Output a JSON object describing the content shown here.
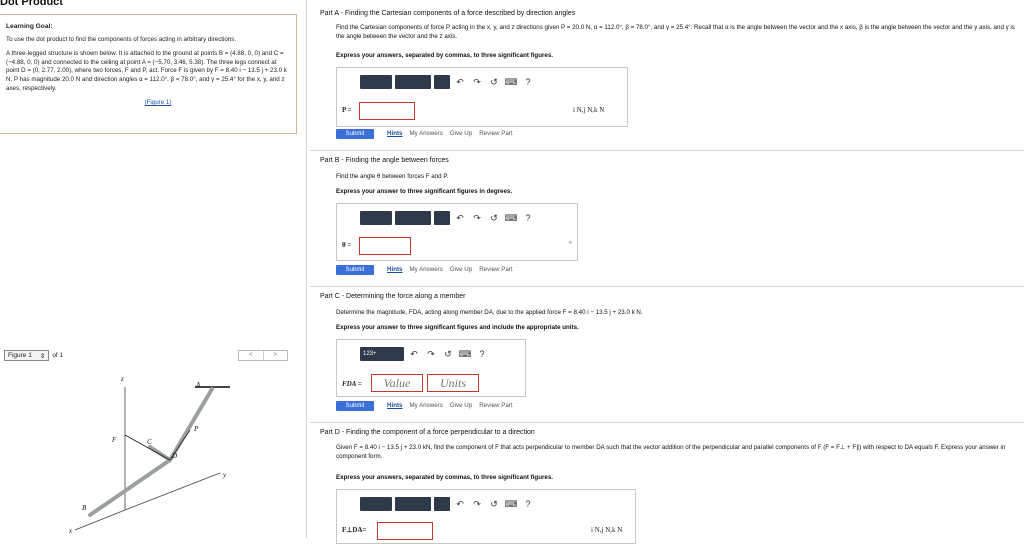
{
  "header": {
    "title": "Dot Product"
  },
  "learning_goal": {
    "heading": "Learning Goal:",
    "text": "To use the dot product to find the components of forces acting in arbitrary directions.",
    "problem": "A three-legged structure is shown below. It is attached to the ground at points B = (4.88, 0, 0) and C = (−4.88, 0, 0) and connected to the ceiling at point A = (−5.70, 3.46, 5.38). The three legs connect at point D = (0, 2.77, 2.00), where two forces, F and P, act. Force F is given by F = 8.40 i − 13.5 j + 23.0 k N; P has magnitude 20.0 N and direction angles α = 112.0°, β = 78.0°, and γ = 25.4° for the x, y, and z axes, respectively.",
    "figure_link": "(Figure 1)"
  },
  "figure_nav": {
    "label": "Figure 1",
    "of": "of 1",
    "prev": "<",
    "next": ">"
  },
  "figure": {
    "labels": {
      "z": "z",
      "A": "A",
      "P": "P",
      "F": "F",
      "C": "C",
      "D": "D",
      "B": "B",
      "x": "x",
      "y": "y"
    }
  },
  "part_a": {
    "title": "Part A - Finding the Cartesian components of a force described by direction angles",
    "prompt": "Find the Cartesian components of force P acting in the x, y, and z directions given P = 20.0 N, α = 112.0°, β = 78.0°, and γ = 25.4°. Recall that α is the angle between the vector and the x axis, β is the angle between the vector and the y axis, and γ is the angle between the vector and the z axis.",
    "instruction": "Express your answers, separated by commas, to three significant figures.",
    "var": "P =",
    "units": "i N,j N,k N",
    "toolbar_q": "?"
  },
  "part_b": {
    "title": "Part B - Finding the angle between forces",
    "prompt": "Find the angle θ between forces F and P.",
    "instruction": "Express your answer to three significant figures in degrees.",
    "var": "θ =",
    "units": "°",
    "toolbar_q": "?"
  },
  "part_c": {
    "title": "Part C - Determining the force along a member",
    "prompt": "Determine the magnitude, FDA, acting along member DA, due to the applied force F = 8.40 i − 13.5 j + 23.0 k N.",
    "instruction": "Express your answer to three significant figures and include the appropriate units.",
    "var": "FDA =",
    "value_placeholder": "Value",
    "units_placeholder": "Units",
    "keypad": "123+",
    "toolbar_q": "?"
  },
  "part_d": {
    "title": "Part D - Finding the component of a force perpendicular to a direction",
    "prompt": "Given F = 8.40 i − 13.5 j + 23.0 kN, find the component of F that acts perpendicular to member DA such that the vector addition of the perpendicular and parallel components of F (F = F⊥ + F∥) with respect to DA equals F. Express your answer in component form.",
    "instruction": "Express your answers, separated by commas, to three significant figures.",
    "var": "F⊥DA=",
    "units": "i N,j N,k N",
    "toolbar_q": "?"
  },
  "actions": {
    "submit": "Submit",
    "hints": "Hints",
    "my_answers": "My Answers",
    "give_up": "Give Up",
    "review": "Review Part"
  },
  "colors": {
    "accent": "#3a6fd8",
    "error_border": "#c0392b",
    "toolbar_block": "#2e3a4a"
  }
}
